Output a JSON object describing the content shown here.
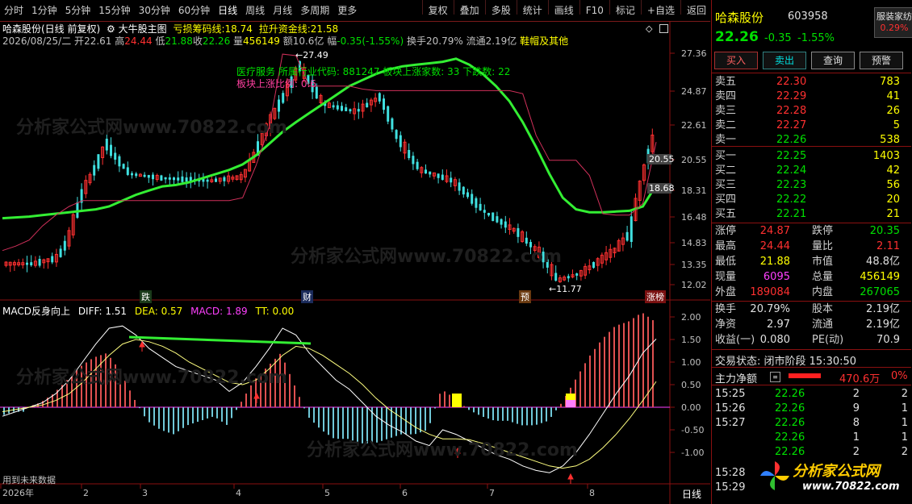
{
  "toolbar": {
    "left": [
      "分时",
      "1分钟",
      "5分钟",
      "15分钟",
      "30分钟",
      "60分钟",
      "日线",
      "周线",
      "月线",
      "多周期",
      "更多"
    ],
    "active": "日线",
    "right": [
      "复权",
      "叠加",
      "多股",
      "统计",
      "画线",
      "F10",
      "标记",
      "+自选",
      "返回"
    ]
  },
  "info": {
    "stock_line": "哈森股份(日线 前复权)",
    "indicator_name": "大牛股主图",
    "loss_chip_label": "亏损筹码线:",
    "loss_chip_value": "18.74",
    "pull_fund_label": "拉升资金线:",
    "pull_fund_value": "21.58",
    "date": "2026/08/25/二",
    "open_label": "开",
    "open": "22.61",
    "high_label": "高",
    "high": "24.44",
    "low_label": "低",
    "low": "21.88",
    "close_label": "收",
    "close": "22.26",
    "vol_label": "量",
    "vol": "456149",
    "amount_label": "额",
    "amount": "10.6亿",
    "change_label": "幅",
    "change": "-0.35(-1.55%)",
    "turnover": "换手20.79%",
    "float": "流通2.19亿",
    "sector": "鞋帽及其他"
  },
  "chart_annotations": {
    "sector_text": "医疗服务  所属行业代码: 881247  板块上涨家数: 33 下跌数: 22",
    "sector_rise_label": "板块上涨比例: 0.6",
    "high_mark": "27.49",
    "low_mark": "11.77",
    "badges": [
      "跌",
      "财",
      "预",
      "涨榜"
    ]
  },
  "chart_data": [
    {
      "type": "candlestick",
      "title": "大牛股主图",
      "y_ticks": [
        "27.36",
        "24.87",
        "22.61",
        "20.55",
        "18.31",
        "16.48",
        "14.83",
        "13.35",
        "12.02"
      ],
      "price_labels": [
        "20.55",
        "18.68"
      ],
      "x_ticks": [
        "2026年",
        "2",
        "3",
        "4",
        "5",
        "6",
        "7",
        "8"
      ],
      "series": [
        {
          "name": "亏损筹码线",
          "color": "#33ee33",
          "values": [
            16.4,
            16.45,
            16.5,
            16.6,
            16.7,
            16.8,
            16.9,
            17.0,
            17.2,
            17.6,
            18.0,
            18.3,
            18.6,
            18.7,
            18.9,
            19.2,
            19.5,
            19.8,
            20.2,
            20.8,
            21.5,
            22.2,
            22.8,
            23.4,
            24.0,
            24.6,
            25.2,
            25.6,
            26.0,
            26.3,
            26.5,
            26.6,
            26.7,
            26.8,
            27.0,
            26.6,
            26.0,
            25.2,
            24.2,
            22.8,
            21.3,
            19.5,
            17.8,
            17.0,
            16.8,
            16.8,
            16.85,
            16.9,
            17.2,
            18.7
          ]
        },
        {
          "name": "拉升资金线",
          "color": "#d0305a",
          "values": [
            14.3,
            14.6,
            15.0,
            15.9,
            16.6,
            17.2,
            17.6,
            17.6,
            17.6,
            17.6,
            17.6,
            17.6,
            17.6,
            17.6,
            17.6,
            17.6,
            17.6,
            17.6,
            17.8,
            20.1,
            22.5,
            27.3,
            27.2,
            25.2,
            25.2,
            25.2,
            25.2,
            25.0,
            24.9,
            24.9,
            24.9,
            24.9,
            24.9,
            24.9,
            24.9,
            24.9,
            24.9,
            24.9,
            24.9,
            24.7,
            22.0,
            20.5,
            20.5,
            20.5,
            19.4,
            16.7,
            16.6,
            16.6,
            17.4,
            21.6
          ]
        }
      ]
    },
    {
      "type": "bar",
      "title": "MACD反身向上",
      "y_ticks": [
        "2.00",
        "1.50",
        "1.00",
        "0.50",
        "0.00",
        "-0.50",
        "-1.00"
      ],
      "ylim": [
        -1.5,
        2.2
      ],
      "series": [
        {
          "name": "DIFF",
          "value": "1.51",
          "color": "#ffffff",
          "values": [
            -0.2,
            -0.1,
            0.0,
            0.1,
            0.3,
            0.6,
            1.0,
            1.4,
            1.75,
            1.8,
            1.6,
            1.3,
            1.1,
            0.9,
            0.8,
            0.7,
            0.6,
            0.35,
            0.55,
            0.9,
            1.3,
            1.75,
            1.6,
            1.2,
            0.9,
            0.6,
            0.4,
            0.1,
            -0.2,
            -0.4,
            -0.55,
            -0.75,
            -0.85,
            -0.5,
            -0.6,
            -0.75,
            -0.9,
            -1.05,
            -1.15,
            -1.3,
            -1.4,
            -1.45,
            -1.3,
            -1.0,
            -0.6,
            -0.15,
            0.3,
            0.7,
            1.2,
            1.51
          ]
        },
        {
          "name": "DEA",
          "value": "0.57",
          "color": "#ffff80",
          "values": [
            -0.1,
            -0.05,
            0.0,
            0.05,
            0.15,
            0.3,
            0.55,
            0.85,
            1.15,
            1.4,
            1.5,
            1.45,
            1.35,
            1.2,
            1.0,
            0.85,
            0.7,
            0.55,
            0.5,
            0.6,
            0.85,
            1.15,
            1.35,
            1.3,
            1.15,
            0.95,
            0.75,
            0.5,
            0.2,
            -0.05,
            -0.25,
            -0.45,
            -0.6,
            -0.7,
            -0.7,
            -0.72,
            -0.8,
            -0.9,
            -1.0,
            -1.1,
            -1.2,
            -1.3,
            -1.35,
            -1.3,
            -1.15,
            -0.9,
            -0.6,
            -0.25,
            0.15,
            0.57
          ]
        },
        {
          "name": "MACD",
          "value": "1.89",
          "color": "#ff40ff",
          "values": [
            -0.2,
            -0.1,
            0.0,
            0.1,
            0.3,
            0.6,
            0.9,
            1.1,
            1.2,
            0.8,
            0.2,
            -0.3,
            -0.5,
            -0.6,
            -0.4,
            -0.3,
            -0.2,
            -0.4,
            0.1,
            0.6,
            0.9,
            1.2,
            0.5,
            -0.2,
            -0.5,
            -0.7,
            -0.7,
            -0.8,
            -0.8,
            -0.7,
            -0.6,
            -0.6,
            -0.5,
            0.4,
            0.2,
            -0.05,
            -0.2,
            -0.3,
            -0.3,
            -0.4,
            -0.4,
            -0.3,
            0.1,
            0.6,
            1.1,
            1.5,
            1.8,
            1.9,
            2.1,
            1.89
          ]
        },
        {
          "name": "TT",
          "value": "0.00",
          "color": "#ffff00",
          "values": []
        }
      ]
    }
  ],
  "sub_chart": {
    "footer": "用到未来数据",
    "period": "日线"
  },
  "panel": {
    "name": "哈森股份",
    "code": "603958",
    "sector_badge": "服装家纺",
    "sector_change": "0.29%",
    "price": "22.26",
    "change": "-0.35",
    "change_pct": "-1.55%",
    "buttons": [
      "买入",
      "卖出",
      "查询",
      "预警"
    ],
    "sells": [
      {
        "label": "卖五",
        "price": "22.30",
        "vol": "783"
      },
      {
        "label": "卖四",
        "price": "22.29",
        "vol": "41"
      },
      {
        "label": "卖三",
        "price": "22.28",
        "vol": "26"
      },
      {
        "label": "卖二",
        "price": "22.27",
        "vol": "5"
      },
      {
        "label": "卖一",
        "price": "22.26",
        "vol": "538"
      }
    ],
    "buys": [
      {
        "label": "买一",
        "price": "22.25",
        "vol": "1403"
      },
      {
        "label": "买二",
        "price": "22.24",
        "vol": "42"
      },
      {
        "label": "买三",
        "price": "22.23",
        "vol": "56"
      },
      {
        "label": "买四",
        "price": "22.22",
        "vol": "20"
      },
      {
        "label": "买五",
        "price": "22.21",
        "vol": "21"
      }
    ],
    "stats": [
      {
        "l1": "涨停",
        "v1": "24.87",
        "c1": "#ff3030",
        "l2": "跌停",
        "v2": "20.35",
        "c2": "#00e000"
      },
      {
        "l1": "最高",
        "v1": "24.44",
        "c1": "#ff3030",
        "l2": "量比",
        "v2": "2.11",
        "c2": "#ff3030"
      },
      {
        "l1": "最低",
        "v1": "21.88",
        "c1": "#ffff00",
        "l2": "市值",
        "v2": "48.8亿",
        "c2": "#e0e0e0"
      },
      {
        "l1": "现量",
        "v1": "6095",
        "c1": "#ff40ff",
        "l2": "总量",
        "v2": "456149",
        "c2": "#ffff00"
      },
      {
        "l1": "外盘",
        "v1": "189084",
        "c1": "#ff3030",
        "l2": "内盘",
        "v2": "267065",
        "c2": "#00e000"
      }
    ],
    "stats2": [
      {
        "l1": "换手",
        "v1": "20.79%",
        "l2": "股本",
        "v2": "2.19亿"
      },
      {
        "l1": "净资",
        "v1": "2.97",
        "l2": "流通",
        "v2": "2.19亿"
      },
      {
        "l1": "收益(一)",
        "v1": "0.080",
        "l2": "PE(动)",
        "v2": "70.9"
      }
    ],
    "trade_state": "交易状态: 闭市阶段 15:30:50",
    "main_flow_label": "主力净额",
    "main_flow_value": "470.6万",
    "main_flow_pct": "0%",
    "ticks": [
      {
        "t": "15:25",
        "p": "22.26",
        "v": "2",
        "n": "2"
      },
      {
        "t": "15:26",
        "p": "22.26",
        "v": "9",
        "n": "1"
      },
      {
        "t": "15:27",
        "p": "22.26",
        "v": "8",
        "n": "1"
      },
      {
        "t": "",
        "p": "22.26",
        "v": "1",
        "n": "1"
      },
      {
        "t": "",
        "p": "22.26",
        "v": "2",
        "n": "2"
      },
      {
        "t": "15:28",
        "p": "",
        "v": "",
        "n": ""
      },
      {
        "t": "15:29",
        "p": "",
        "v": "",
        "n": ""
      }
    ],
    "logo_text": "分析家公式网",
    "logo_url": "www.70822.com"
  },
  "colors": {
    "up": "#ff3030",
    "down": "#00e0e0",
    "grid": "#8a1010",
    "bg": "#000000"
  }
}
